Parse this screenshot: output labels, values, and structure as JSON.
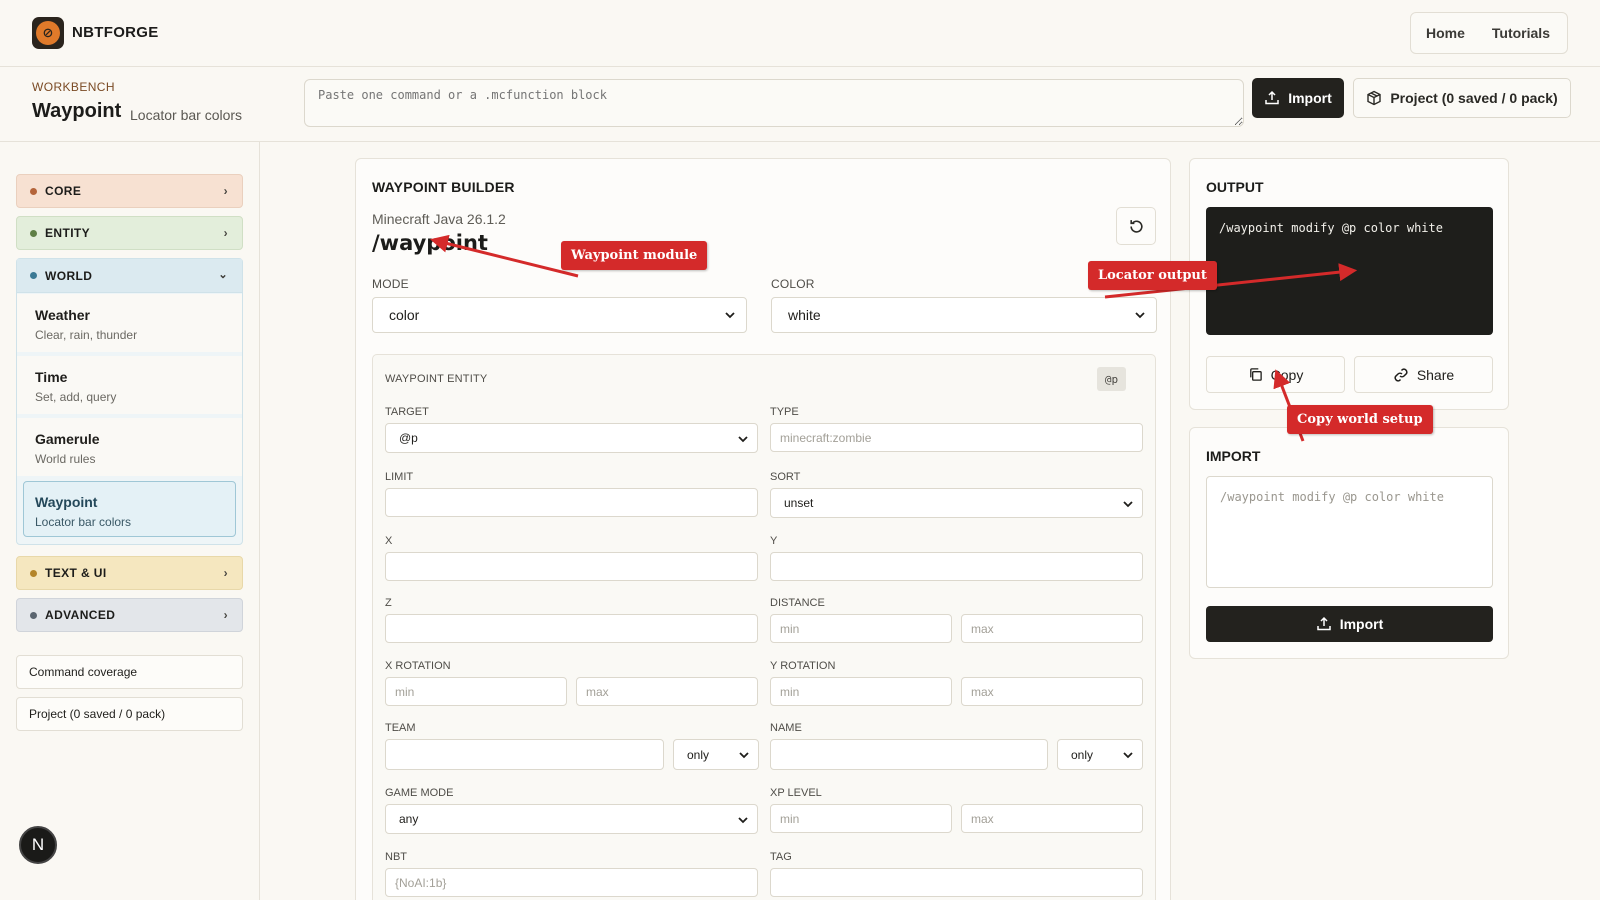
{
  "app": {
    "brand": "NBTFORGE"
  },
  "nav": {
    "home": "Home",
    "tutorials": "Tutorials"
  },
  "workbench": {
    "eyebrow": "WORKBENCH",
    "title": "Waypoint",
    "subtitle": "Locator bar colors",
    "command_placeholder": "Paste one command or a .mcfunction block",
    "import_label": "Import",
    "project_label": "Project (0 saved / 0 pack)"
  },
  "sidebar": {
    "core": "CORE",
    "entity": "ENTITY",
    "world": "WORLD",
    "world_items": [
      {
        "title": "Weather",
        "desc": "Clear, rain, thunder"
      },
      {
        "title": "Time",
        "desc": "Set, add, query"
      },
      {
        "title": "Gamerule",
        "desc": "World rules"
      },
      {
        "title": "Waypoint",
        "desc": "Locator bar colors"
      }
    ],
    "text_ui": "TEXT & UI",
    "advanced": "ADVANCED",
    "coverage": "Command coverage",
    "project": "Project (0 saved / 0 pack)",
    "badge": "N"
  },
  "builder": {
    "title": "WAYPOINT BUILDER",
    "version": "Minecraft Java 26.1.2",
    "command": "/waypoint",
    "mode_label": "MODE",
    "mode_value": "color",
    "color_label": "COLOR",
    "color_value": "white",
    "entity": {
      "title": "WAYPOINT ENTITY",
      "badge": "@p",
      "target_label": "TARGET",
      "target_value": "@p",
      "type_label": "TYPE",
      "type_placeholder": "minecraft:zombie",
      "limit_label": "LIMIT",
      "sort_label": "SORT",
      "sort_value": "unset",
      "x_label": "X",
      "y_label": "Y",
      "z_label": "Z",
      "distance_label": "DISTANCE",
      "xrot_label": "X ROTATION",
      "yrot_label": "Y ROTATION",
      "team_label": "TEAM",
      "team_mode": "only",
      "name_label": "NAME",
      "name_mode": "only",
      "gamemode_label": "GAME MODE",
      "gamemode_value": "any",
      "xp_label": "XP LEVEL",
      "nbt_label": "NBT",
      "nbt_placeholder": "{NoAI:1b}",
      "tag_label": "TAG",
      "min": "min",
      "max": "max"
    }
  },
  "output": {
    "title": "OUTPUT",
    "command": "/waypoint modify @p color white",
    "copy": "Copy",
    "share": "Share"
  },
  "import": {
    "title": "IMPORT",
    "placeholder": "/waypoint modify @p color white",
    "button": "Import"
  },
  "annotations": {
    "waypoint_module": "Waypoint module",
    "locator_output": "Locator output",
    "copy_world_setup": "Copy world setup"
  },
  "colors": {
    "annotation": "#d42a2a",
    "dark_button": "#23221e",
    "terminal": "#1e1e1b"
  }
}
